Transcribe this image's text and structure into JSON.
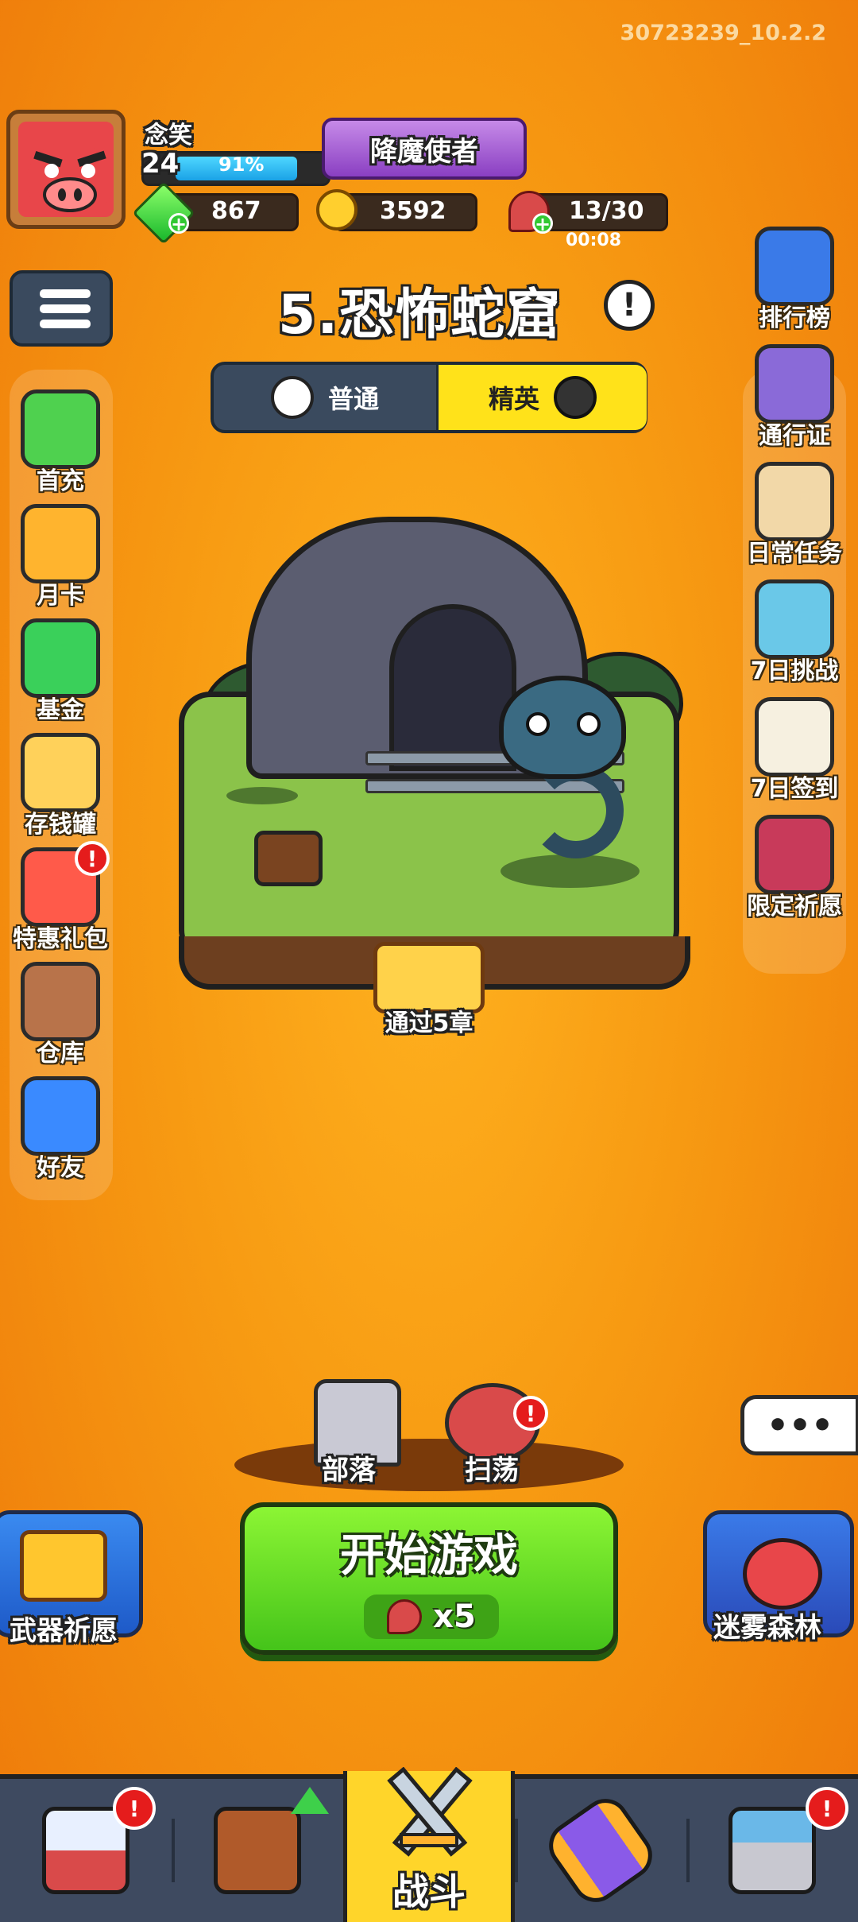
{
  "build": "30723239_10.2.2",
  "player": {
    "name": "念笑",
    "level": "24",
    "exp_percent": "91%",
    "exp_fraction": 0.91,
    "title": "降魔使者"
  },
  "resources": {
    "gems": "867",
    "coins": "3592",
    "stamina": "13/30",
    "stamina_timer": "00:08"
  },
  "stage": {
    "title": "5.恐怖蛇窟",
    "modes": {
      "normal": "普通",
      "elite": "精英"
    },
    "selected_mode": "elite",
    "reward_label": "通过5章"
  },
  "left_menu": [
    {
      "label": "首充",
      "icon": "gem-bag-icon",
      "color": "#4fd14f",
      "alert": false
    },
    {
      "label": "月卡",
      "icon": "month-card-icon",
      "color": "#ffb42e",
      "alert": false
    },
    {
      "label": "基金",
      "icon": "fund-gem-icon",
      "color": "#3ad05a",
      "alert": false
    },
    {
      "label": "存钱罐",
      "icon": "piggy-bank-cat-icon",
      "color": "#ffd15a",
      "alert": false
    },
    {
      "label": "特惠礼包",
      "icon": "gift-box-icon",
      "color": "#ff5a4a",
      "alert": true
    },
    {
      "label": "仓库",
      "icon": "backpack-icon",
      "color": "#b8734a",
      "alert": false
    },
    {
      "label": "好友",
      "icon": "friends-icon",
      "color": "#3a8aff",
      "alert": false
    }
  ],
  "right_menu": [
    {
      "label": "排行榜",
      "icon": "trophy-crown-icon",
      "color": "#3a7ae8"
    },
    {
      "label": "通行证",
      "icon": "pass-shield-icon",
      "color": "#8a6ad8"
    },
    {
      "label": "日常任务",
      "icon": "scroll-quill-icon",
      "color": "#f2d8a8"
    },
    {
      "label": "7日挑战",
      "icon": "seven-day-challenge-icon",
      "color": "#6ac8e8"
    },
    {
      "label": "7日签到",
      "icon": "calendar-check-icon",
      "color": "#f6f0e0"
    },
    {
      "label": "限定祈愿",
      "icon": "limited-wish-icon",
      "color": "#c83a5a"
    }
  ],
  "bottom": {
    "tribe": "部落",
    "sweep": "扫荡",
    "start_label": "开始游戏",
    "start_cost": "x5",
    "weapon_wish": "武器祈愿",
    "mist_forest": "迷雾森林",
    "chat_icon": "chat-bubble-icon"
  },
  "nav": [
    {
      "name": "shop",
      "icon": "shop-icon",
      "alert": true
    },
    {
      "name": "pig-chest",
      "icon": "pig-chest-icon",
      "alert": false,
      "upgrade": true
    },
    {
      "name": "battle",
      "icon": "crossed-swords-icon",
      "label": "战斗",
      "active": true
    },
    {
      "name": "gacha",
      "icon": "scroll-capsule-icon",
      "alert": false
    },
    {
      "name": "building",
      "icon": "building-icon",
      "alert": true
    }
  ],
  "colors": {
    "background": "#f79a12",
    "accent_yellow": "#ffe21a",
    "start_green": "#6be02a",
    "alert_red": "#e51c1c"
  }
}
